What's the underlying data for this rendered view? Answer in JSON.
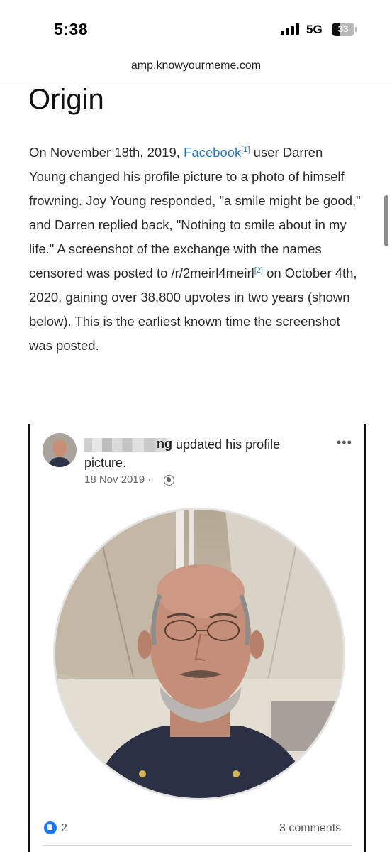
{
  "status_bar": {
    "time": "5:38",
    "network": "5G",
    "battery": "33"
  },
  "browser": {
    "url": "amp.knowyourmeme.com"
  },
  "article": {
    "heading": "Origin",
    "para": {
      "t1": "On November 18th, 2019, ",
      "link1": "Facebook",
      "ref1": "[1]",
      "t2": " user Darren Young changed his profile picture to a photo of himself frowning. Joy Young responded, \"a smile might be good,\" and Darren replied back, \"Nothing to smile about in my life.\" A screenshot of the exchange with the names censored was posted to /r/2meirl4meirl",
      "ref2": "[2]",
      "t3": " on October 4th, 2020, gaining over 38,800 upvotes in two years (shown below). This is the earliest known time the screenshot was posted."
    }
  },
  "embed": {
    "name_tail": "ng",
    "action_line1": "updated his profile",
    "action_line2": "picture.",
    "date": "18 Nov 2019 ·",
    "more": "•••",
    "likes": "2",
    "comments": "3 comments",
    "icons": {
      "privacy": "globe-icon",
      "reaction": "like-icon",
      "menu": "more-icon"
    }
  }
}
